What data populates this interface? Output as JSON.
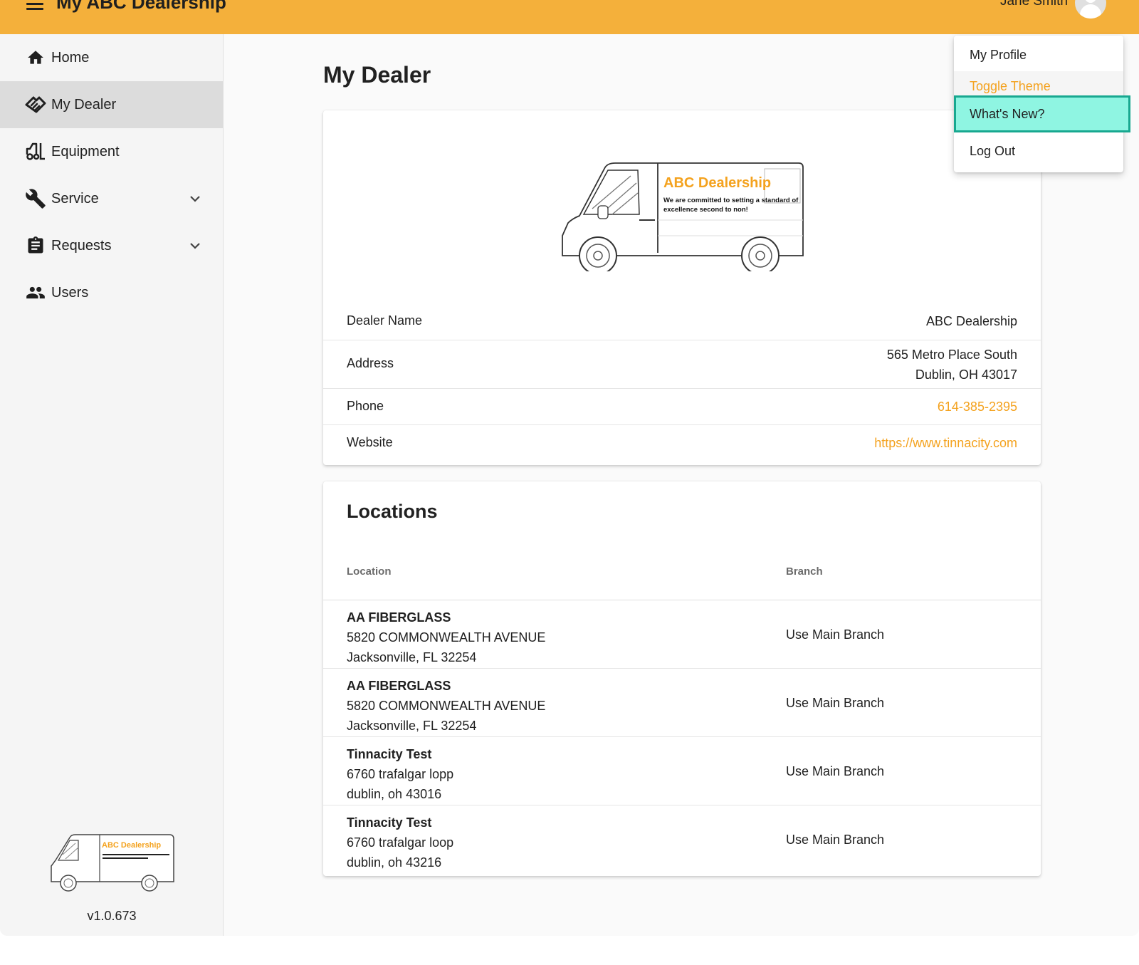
{
  "appbar": {
    "title": "My ABC Dealership",
    "user_name": "Jane Smith"
  },
  "sidebar": {
    "items": [
      {
        "label": "Home",
        "icon": "home-icon"
      },
      {
        "label": "My Dealer",
        "icon": "handshake-icon",
        "active": true
      },
      {
        "label": "Equipment",
        "icon": "forklift-icon"
      },
      {
        "label": "Service",
        "icon": "wrench-icon",
        "expandable": true
      },
      {
        "label": "Requests",
        "icon": "clipboard-icon",
        "expandable": true
      },
      {
        "label": "Users",
        "icon": "users-icon"
      }
    ],
    "logo_text": "ABC Dealership",
    "logo_tagline": "We are committed to setting a standard of excellence second to non!",
    "version": "v1.0.673"
  },
  "page": {
    "title": "My Dealer"
  },
  "dealer": {
    "logo_text": "ABC Dealership",
    "logo_tagline_line1": "We are committed to setting a standard of",
    "logo_tagline_line2": "excellence second to non!",
    "rows": [
      {
        "label": "Dealer Name",
        "value": "ABC Dealership"
      },
      {
        "label": "Address",
        "value_line1": "565 Metro Place South",
        "value_line2": "Dublin, OH 43017"
      },
      {
        "label": "Phone",
        "value": "614-385-2395"
      },
      {
        "label": "Website",
        "value": "https://www.tinnacity.com"
      }
    ]
  },
  "locations": {
    "heading": "Locations",
    "columns": [
      "Location",
      "Branch"
    ],
    "rows": [
      {
        "name": "AA FIBERGLASS",
        "street": "5820 COMMONWEALTH AVENUE",
        "city": "Jacksonville, FL 32254",
        "branch": "Use Main Branch"
      },
      {
        "name": "AA FIBERGLASS",
        "street": "5820 COMMONWEALTH AVENUE",
        "city": "Jacksonville, FL 32254",
        "branch": "Use Main Branch"
      },
      {
        "name": "Tinnacity Test",
        "street": "6760 trafalgar lopp",
        "city": "dublin, oh 43016",
        "branch": "Use Main Branch"
      },
      {
        "name": "Tinnacity Test",
        "street": "6760 trafalgar loop",
        "city": "dublin, oh 43216",
        "branch": "Use Main Branch"
      }
    ]
  },
  "user_menu": {
    "items": [
      "My Profile",
      "Toggle Theme",
      "What's New?",
      "Log Out"
    ]
  },
  "colors": {
    "appbar": "#f4b03b",
    "accent": "#f4a21e",
    "highlight": "#8ff5e2",
    "highlight_border": "#18a890",
    "sidebar_active": "#dcdcdc"
  }
}
